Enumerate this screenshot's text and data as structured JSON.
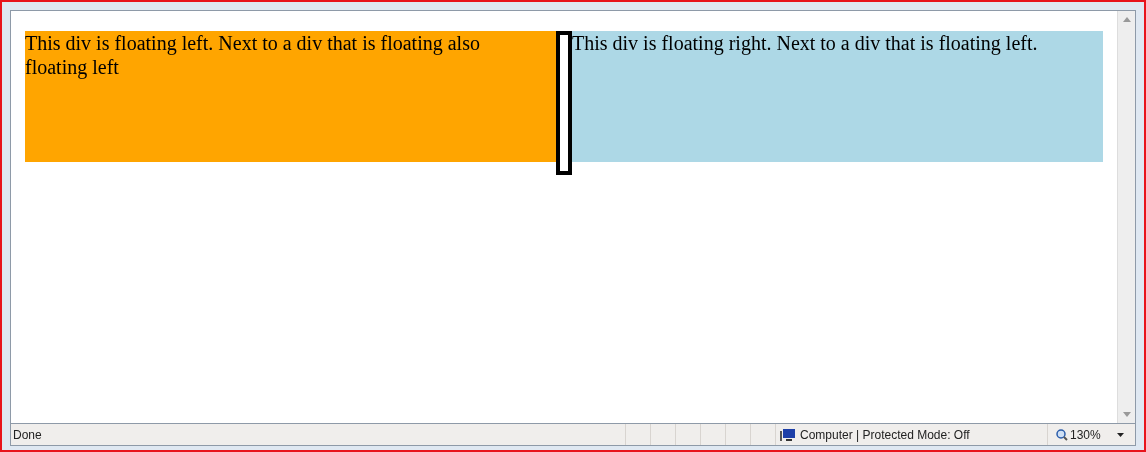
{
  "page": {
    "left_div": "This div is floating left. Next to a div that is floating also floating left",
    "right_div": "This div is floating right. Next to a div that is floating left."
  },
  "status_bar": {
    "status": "Done",
    "zone": "Computer | Protected Mode: Off",
    "zoom": "130%"
  }
}
